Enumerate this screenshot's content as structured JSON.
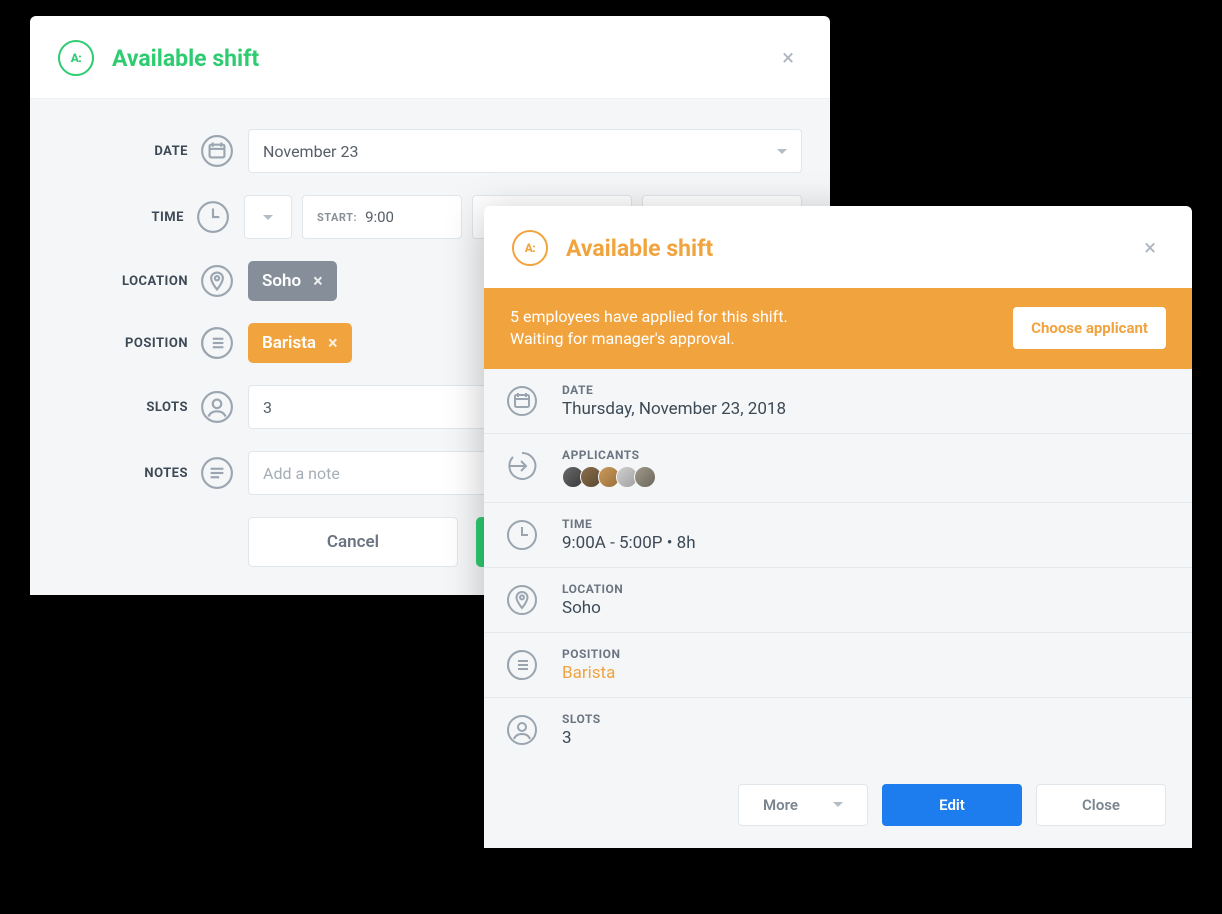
{
  "edit_modal": {
    "title": "Available shift",
    "labels": {
      "date": "DATE",
      "time": "TIME",
      "location": "LOCATION",
      "position": "POSITION",
      "slots": "SLOTS",
      "notes": "NOTES"
    },
    "date_value": "November 23",
    "time": {
      "start_label": "START:",
      "start_value": "9:00"
    },
    "location_chip": "Soho",
    "position_chip": "Barista",
    "slots_value": "3",
    "notes_placeholder": "Add a note",
    "buttons": {
      "cancel": "Cancel"
    }
  },
  "detail_modal": {
    "title": "Available shift",
    "banner": {
      "line1": "5 employees have applied for this shift.",
      "line2": "Waiting for manager's approval.",
      "action": "Choose applicant"
    },
    "rows": {
      "date_label": "DATE",
      "date_value": "Thursday, November 23, 2018",
      "applicants_label": "APPLICANTS",
      "applicant_count": 5,
      "time_label": "TIME",
      "time_value": "9:00A - 5:00P • 8h",
      "location_label": "LOCATION",
      "location_value": "Soho",
      "position_label": "POSITION",
      "position_value": "Barista",
      "slots_label": "SLOTS",
      "slots_value": "3"
    },
    "footer": {
      "more": "More",
      "edit": "Edit",
      "close": "Close"
    }
  }
}
